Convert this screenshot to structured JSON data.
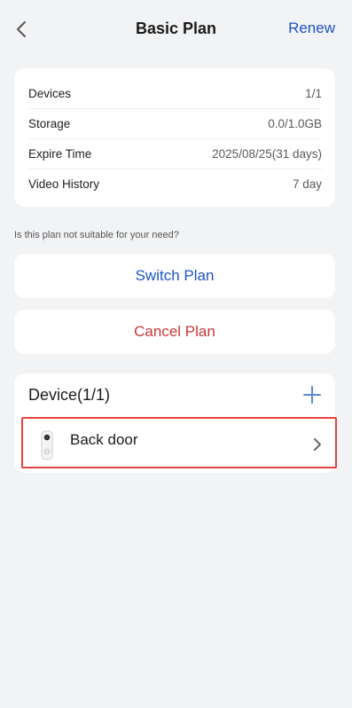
{
  "header": {
    "title": "Basic Plan",
    "renew_label": "Renew",
    "back_icon": "chevron-left-icon"
  },
  "plan_info": {
    "rows": [
      {
        "label": "Devices",
        "value": "1/1"
      },
      {
        "label": "Storage",
        "value": "0.0/1.0GB"
      },
      {
        "label": "Expire Time",
        "value": "2025/08/25(31 days)"
      },
      {
        "label": "Video History",
        "value": "7 day"
      }
    ]
  },
  "hint": "Is this plan not suitable for your need?",
  "actions": {
    "switch_label": "Switch Plan",
    "cancel_label": "Cancel Plan"
  },
  "devices": {
    "header": "Device(1/1)",
    "add_icon": "plus-icon",
    "items": [
      {
        "name": "Back door",
        "icon": "doorbell-camera-icon"
      }
    ]
  },
  "colors": {
    "accent": "#1c55c4",
    "danger": "#c8383a",
    "highlight": "#e4433d",
    "background": "#f2f3f5"
  }
}
